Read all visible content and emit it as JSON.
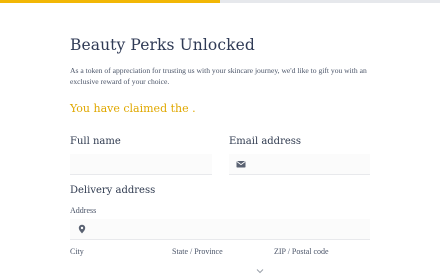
{
  "progress": {
    "fraction": 0.5
  },
  "page": {
    "title": "Beauty Perks Unlocked",
    "intro": "As a token of appreciation for trusting us with your skincare journey, we'd like to gift you with an exclusive reward of your choice.",
    "claimed_text": "You have claimed the ."
  },
  "form": {
    "full_name_label": "Full name",
    "full_name_value": "",
    "email_label": "Email address",
    "email_value": "",
    "email_icon": "envelope-icon",
    "delivery_heading": "Delivery address",
    "address_label": "Address",
    "address_value": "",
    "address_icon": "map-pin-icon",
    "city_label": "City",
    "state_label": "State / Province",
    "zip_label": "ZIP / Postal code"
  },
  "colors": {
    "accent": "#f2b705",
    "claimed_text": "#e0a800",
    "title": "#2f3a55"
  }
}
